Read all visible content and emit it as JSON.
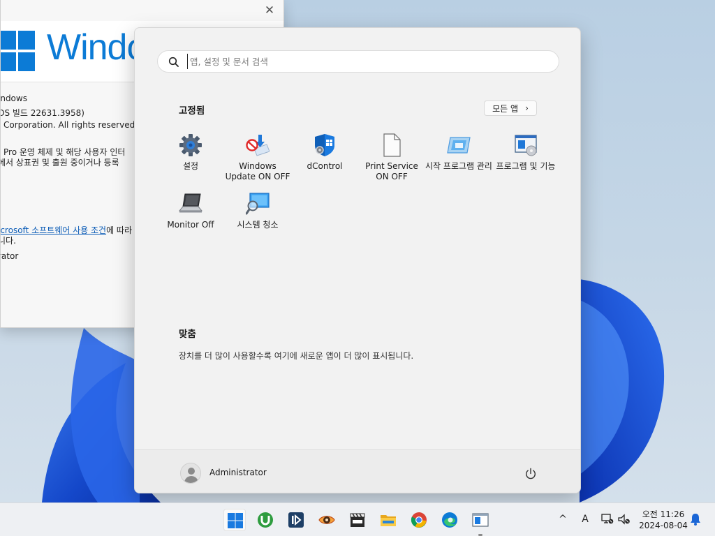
{
  "about_window": {
    "brand_text": "Windo",
    "lines": [
      "indows",
      "OS 빌드 22631.3958)",
      "Corporation. All rights reserved.",
      "Pro 운영 체제 및 해당 사용자 인터",
      "에서 상표권 및 출원 중이거나 등록",
      "icrosoft 소프트웨어 사용 조건",
      "에 따라",
      "니다.",
      "rator"
    ],
    "close_glyph": "✕"
  },
  "start_menu": {
    "search": {
      "placeholder": "앱, 설정 및 문서 검색"
    },
    "pinned": {
      "title": "고정됨",
      "all_apps_label": "모든 앱",
      "all_apps_chevron": "›",
      "apps": [
        {
          "label": "설정",
          "icon": "gear-icon"
        },
        {
          "label": "Windows Update ON OFF",
          "icon": "windows-update-icon"
        },
        {
          "label": "dControl",
          "icon": "shield-icon"
        },
        {
          "label": "Print Service ON OFF",
          "icon": "document-icon"
        },
        {
          "label": "시작 프로그램 관리",
          "icon": "startup-icon"
        },
        {
          "label": "프로그램 및 기능",
          "icon": "programs-icon"
        },
        {
          "label": "Monitor Off",
          "icon": "laptop-icon"
        },
        {
          "label": "시스템 청소",
          "icon": "cleanup-icon"
        }
      ]
    },
    "recommended": {
      "title": "맞춤",
      "empty_text": "장치를 더 많이 사용할수록 여기에 새로운 앱이 더 많이 표시됩니다."
    },
    "user": {
      "name": "Administrator"
    }
  },
  "taskbar": {
    "apps": [
      {
        "name": "start-button",
        "icon": "windows-logo-icon",
        "active": true
      },
      {
        "name": "utorrent",
        "icon": "utorrent-icon"
      },
      {
        "name": "app-blue",
        "icon": "media-icon"
      },
      {
        "name": "app-eye",
        "icon": "eye-icon"
      },
      {
        "name": "mpc-be",
        "icon": "clapper-icon"
      },
      {
        "name": "file-explorer",
        "icon": "folder-icon"
      },
      {
        "name": "chrome",
        "icon": "chrome-icon"
      },
      {
        "name": "edge",
        "icon": "edge-icon"
      },
      {
        "name": "about-window",
        "icon": "window-icon",
        "running": true
      }
    ],
    "tray": {
      "chevron": "^",
      "ime": "A"
    },
    "clock": {
      "time": "오전 11:26",
      "date": "2024-08-04"
    }
  },
  "colors": {
    "accent": "#0c7bd6",
    "bloom": "#1a56d8"
  }
}
